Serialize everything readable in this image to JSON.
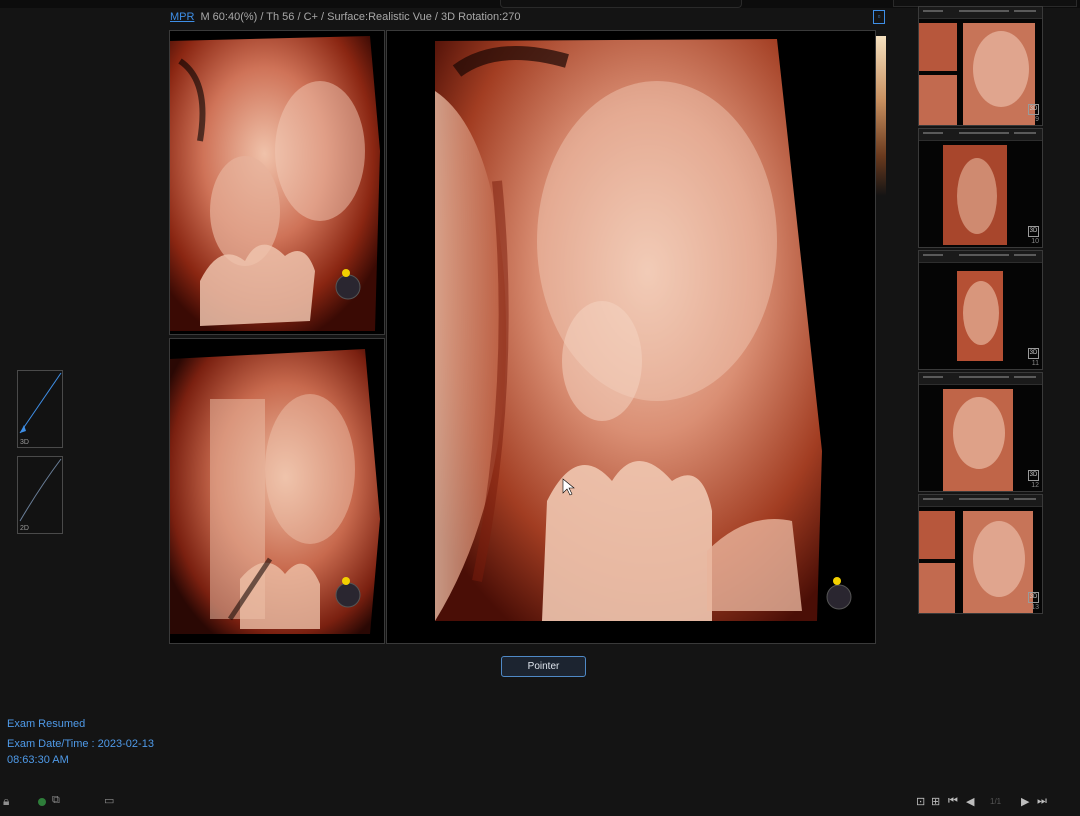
{
  "header": {
    "mode": "MPR",
    "info": "M 60:40(%) / Th 56 / C+ / Surface:Realistic Vue / 3D Rotation:270"
  },
  "pointer_button": {
    "label": "Pointer"
  },
  "curves": [
    {
      "label": "3D"
    },
    {
      "label": "2D"
    }
  ],
  "exam": {
    "status": "Exam Resumed",
    "date": "Exam Date/Time : 2023-02-13",
    "time": "08:63:30 AM"
  },
  "thumbnails": [
    {
      "number": "9"
    },
    {
      "number": "10"
    },
    {
      "number": "11"
    },
    {
      "number": "12"
    },
    {
      "number": "13"
    }
  ],
  "thumb_badge": "3D",
  "page_indicator": "1/1",
  "icons": {
    "lock": "lock-icon",
    "status": "status-dot-icon",
    "monitor": "dual-monitor-icon",
    "printer": "printer-icon",
    "layout1": "single-layout-icon",
    "layout4": "quad-layout-icon",
    "first": "first-page-icon",
    "prev": "prev-page-icon",
    "next": "next-page-icon",
    "last": "last-page-icon"
  },
  "colors": {
    "accent": "#3e8ee6",
    "render_highlight": "#e8b79e",
    "render_mid": "#b5482a",
    "render_shadow": "#5a1208"
  }
}
